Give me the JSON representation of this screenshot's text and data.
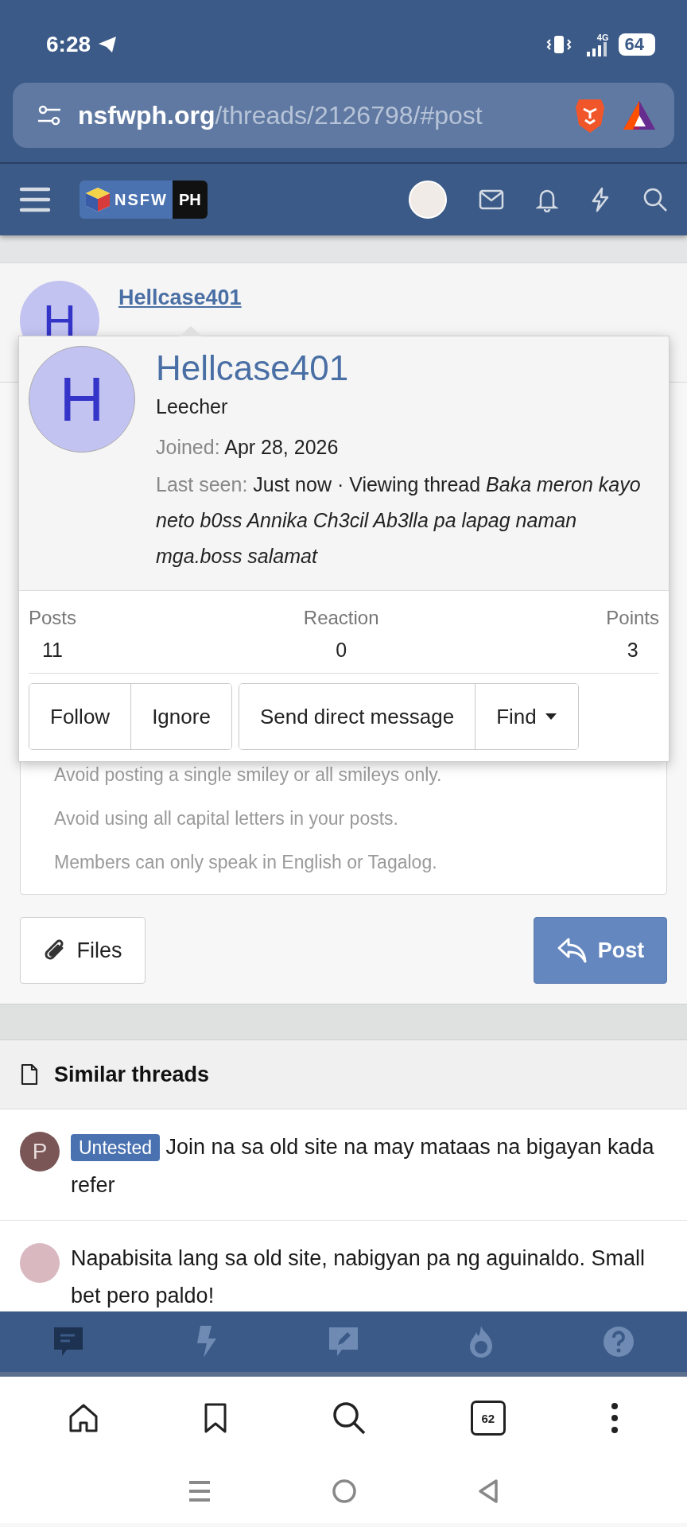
{
  "status_bar": {
    "time": "6:28",
    "network": "4G",
    "battery": "64"
  },
  "browser": {
    "url_domain": "nsfwph.org",
    "url_path": "/threads/2126798/#post",
    "tab_count": "62"
  },
  "site_nav": {
    "logo_left": "NSFW",
    "logo_right": "PH"
  },
  "post": {
    "avatar_letter": "H",
    "author": "Hellcase401"
  },
  "member_card": {
    "avatar_letter": "H",
    "name": "Hellcase401",
    "title": "Leecher",
    "joined_label": "Joined:",
    "joined": "Apr 28, 2026",
    "last_seen_label": "Last seen:",
    "activity": "Just now · Viewing thread *Baka meron kayo neto b0ss Annika Ch3cil Ab3lla pa lapag naman mga.boss salamat*",
    "stats": [
      {
        "label": "Posts",
        "value": "11"
      },
      {
        "label": "Reaction",
        "value": "0"
      },
      {
        "label": "Points",
        "value": "3"
      }
    ],
    "button_groups": [
      [
        {
          "label": "Follow",
          "kind": "plain"
        },
        {
          "label": "Ignore",
          "kind": "plain"
        }
      ],
      [
        {
          "label": "Send direct message",
          "kind": "plain"
        },
        {
          "label": "Find",
          "kind": "menu"
        }
      ]
    ]
  },
  "rules": [
    "Avoid posting a single smiley or all smileys only.",
    "Avoid using all capital letters in your posts.",
    "Members can only speak in English or Tagalog."
  ],
  "composer": {
    "files_button": "Files",
    "post_button": "Post"
  },
  "similar_threads": {
    "title": "Similar threads",
    "threads": [
      {
        "avatar_letter": "P",
        "prefix": "Untested",
        "title": "Join na sa old site na may mataas na bigayan kada refer"
      },
      {
        "title": "Napabisita lang sa old site, nabigyan pa ng aguinaldo. Small bet pero paldo!"
      }
    ]
  },
  "bottom_nav": [
    {
      "kind": "chat",
      "selected": true
    },
    {
      "kind": "bolt",
      "selected": false
    },
    {
      "kind": "compose",
      "selected": false
    },
    {
      "kind": "hot",
      "selected": false
    },
    {
      "kind": "help",
      "selected": false
    }
  ]
}
